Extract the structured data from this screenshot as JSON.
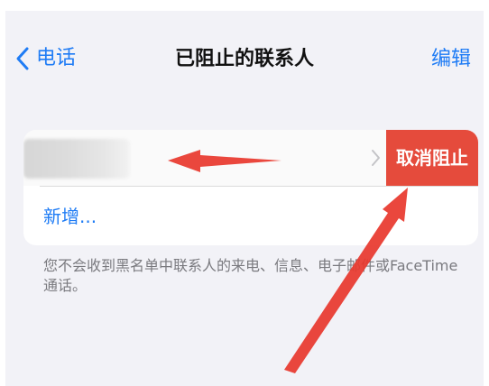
{
  "nav": {
    "back_label": "电话",
    "title": "已阻止的联系人",
    "edit_label": "编辑"
  },
  "contacts": [
    {
      "name_visible": false,
      "action_label": "取消阻止"
    }
  ],
  "add_new_label": "新增...",
  "footnote": "您不会收到黑名单中联系人的来电、信息、电子邮件或FaceTime通话。",
  "colors": {
    "accent": "#1f7cf5",
    "destructive": "#e54b3c",
    "annotation_arrow": "#e8372c",
    "background": "#f2f2f7"
  },
  "icons": {
    "back": "chevron-left-icon",
    "row": "chevron-right-icon"
  }
}
